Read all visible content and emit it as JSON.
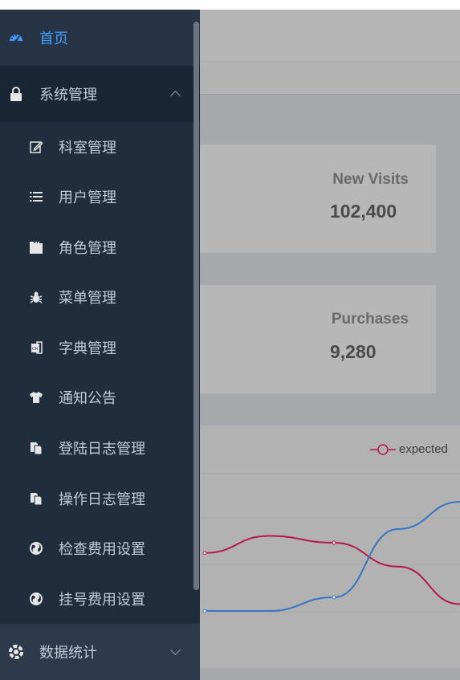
{
  "cards": [
    {
      "label": "New Visits",
      "value": "102,400"
    },
    {
      "label": "Purchases",
      "value": "9,280"
    }
  ],
  "chart_data": {
    "type": "line",
    "series": [
      {
        "name": "expected",
        "color": "#b5174b",
        "y": [
          105,
          130,
          120,
          85,
          30
        ]
      },
      {
        "name": "",
        "color": "#3873c4",
        "y": [
          20,
          20,
          40,
          140,
          180
        ]
      }
    ]
  },
  "legend": {
    "label": "expected"
  },
  "sidebar": {
    "home": {
      "label": "首页",
      "icon": "dashboard-icon"
    },
    "system": {
      "label": "系统管理",
      "icon": "lock-icon"
    },
    "items": [
      {
        "label": "科室管理",
        "icon": "edit-icon"
      },
      {
        "label": "用户管理",
        "icon": "list-icon"
      },
      {
        "label": "角色管理",
        "icon": "folder-icon"
      },
      {
        "label": "菜单管理",
        "icon": "bug-icon"
      },
      {
        "label": "字典管理",
        "icon": "dictionary-icon"
      },
      {
        "label": "通知公告",
        "icon": "shirt-icon"
      },
      {
        "label": "登陆日志管理",
        "icon": "copy-icon"
      },
      {
        "label": "操作日志管理",
        "icon": "copy-icon"
      },
      {
        "label": "检查费用设置",
        "icon": "globe-icon"
      },
      {
        "label": "挂号费用设置",
        "icon": "globe-icon"
      }
    ],
    "stats": {
      "label": "数据统计",
      "icon": "gear-icon"
    }
  },
  "colors": {
    "accent": "#409eff",
    "sidebar_bg": "#1f2d3d",
    "menu_text": "#bfcbd9"
  }
}
